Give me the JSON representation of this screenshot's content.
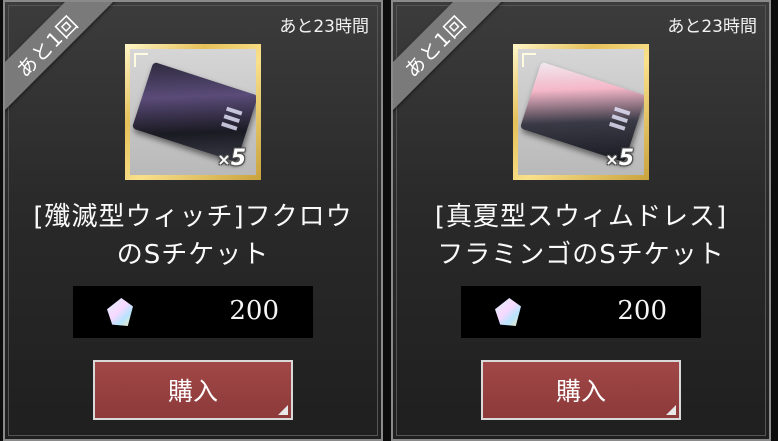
{
  "offers": [
    {
      "limit_label": "あと1回",
      "time_remaining": "あと23時間",
      "item_quantity_prefix": "×",
      "item_quantity": "5",
      "item_name_line1": "[殲滅型ウィッチ]フクロウ",
      "item_name_line2": "のSチケット",
      "price": "200",
      "buy_label": "購入"
    },
    {
      "limit_label": "あと1回",
      "time_remaining": "あと23時間",
      "item_quantity_prefix": "×",
      "item_quantity": "5",
      "item_name_line1": "[真夏型スウィムドレス]",
      "item_name_line2": "フラミンゴのSチケット",
      "price": "200",
      "buy_label": "購入"
    }
  ],
  "icons": {
    "currency": "gem-icon",
    "item": "ticket-icon"
  }
}
